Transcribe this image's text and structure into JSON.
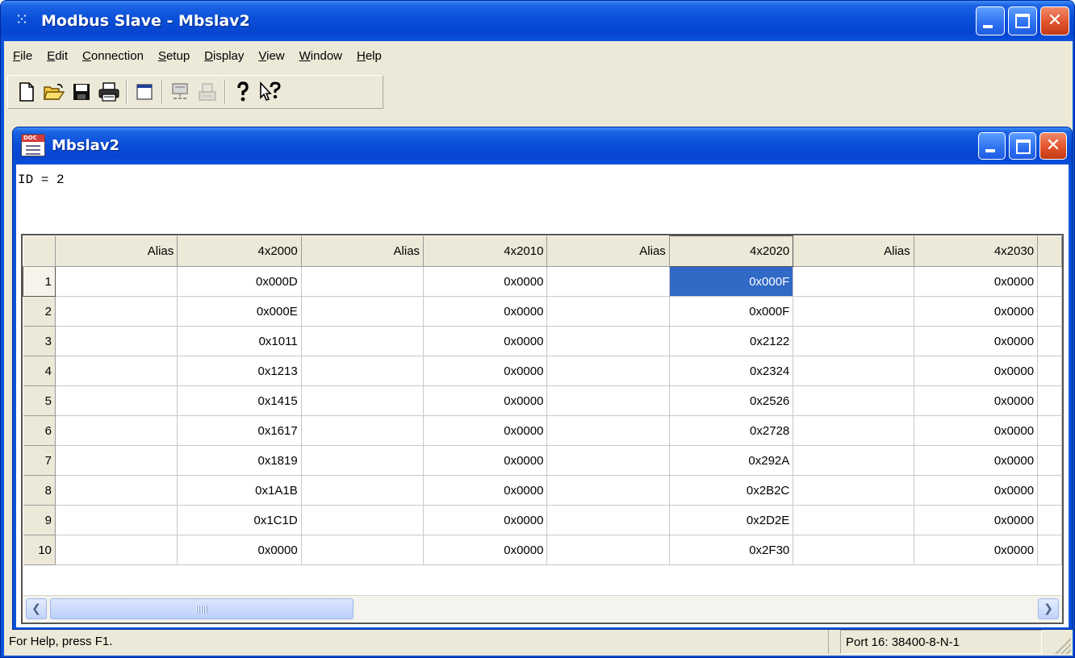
{
  "app": {
    "title": "Modbus Slave - Mbslav2",
    "menu": [
      "File",
      "Edit",
      "Connection",
      "Setup",
      "Display",
      "View",
      "Window",
      "Help"
    ],
    "toolbar": [
      "new-icon",
      "open-icon",
      "save-icon",
      "print-icon",
      "window-icon",
      "connect-icon",
      "disconnect-icon",
      "help-icon",
      "context-help-icon"
    ]
  },
  "child": {
    "title": "Mbslav2",
    "id_line": "ID = 2"
  },
  "grid": {
    "headers": [
      "Alias",
      "4x2000",
      "Alias",
      "4x2010",
      "Alias",
      "4x2020",
      "Alias",
      "4x2030"
    ],
    "rows": [
      {
        "n": "1",
        "c": [
          "",
          "0x000D",
          "",
          "0x0000",
          "",
          "0x000F",
          "",
          "0x0000"
        ]
      },
      {
        "n": "2",
        "c": [
          "",
          "0x000E",
          "",
          "0x0000",
          "",
          "0x000F",
          "",
          "0x0000"
        ]
      },
      {
        "n": "3",
        "c": [
          "",
          "0x1011",
          "",
          "0x0000",
          "",
          "0x2122",
          "",
          "0x0000"
        ]
      },
      {
        "n": "4",
        "c": [
          "",
          "0x1213",
          "",
          "0x0000",
          "",
          "0x2324",
          "",
          "0x0000"
        ]
      },
      {
        "n": "5",
        "c": [
          "",
          "0x1415",
          "",
          "0x0000",
          "",
          "0x2526",
          "",
          "0x0000"
        ]
      },
      {
        "n": "6",
        "c": [
          "",
          "0x1617",
          "",
          "0x0000",
          "",
          "0x2728",
          "",
          "0x0000"
        ]
      },
      {
        "n": "7",
        "c": [
          "",
          "0x1819",
          "",
          "0x0000",
          "",
          "0x292A",
          "",
          "0x0000"
        ]
      },
      {
        "n": "8",
        "c": [
          "",
          "0x1A1B",
          "",
          "0x0000",
          "",
          "0x2B2C",
          "",
          "0x0000"
        ]
      },
      {
        "n": "9",
        "c": [
          "",
          "0x1C1D",
          "",
          "0x0000",
          "",
          "0x2D2E",
          "",
          "0x0000"
        ]
      },
      {
        "n": "10",
        "c": [
          "",
          "0x0000",
          "",
          "0x0000",
          "",
          "0x2F30",
          "",
          "0x0000"
        ]
      }
    ],
    "selected_cell": {
      "row": "1",
      "column": "4x2020"
    }
  },
  "status": {
    "help_text": "For Help, press F1.",
    "port_text": "Port 16: 38400-8-N-1"
  },
  "colors": {
    "titlebar": "#0a4fd8",
    "selection": "#3169c6",
    "client_bg": "#ece9d8",
    "close_button": "#e2532d"
  }
}
